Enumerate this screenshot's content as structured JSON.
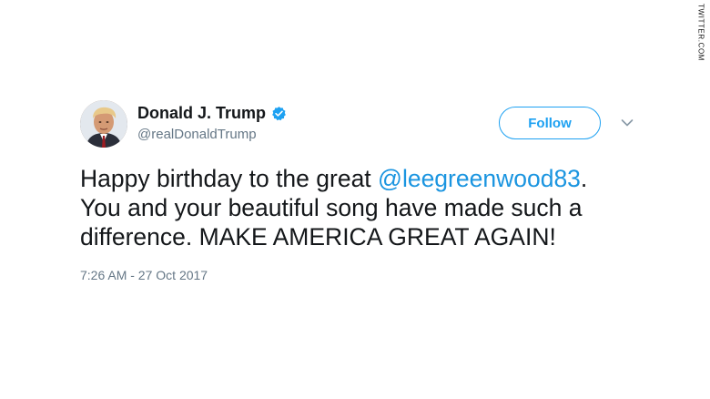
{
  "credit": "TWITTER.COM",
  "tweet": {
    "display_name": "Donald J. Trump",
    "handle": "@realDonaldTrump",
    "follow_label": "Follow",
    "text_before": "Happy birthday to the great ",
    "mention": "@leegreenwood83",
    "text_after": ". You and your beautiful song have made such a difference. MAKE AMERICA GREAT AGAIN!",
    "timestamp": "7:26 AM - 27 Oct 2017"
  },
  "colors": {
    "accent": "#1da1f2",
    "mention": "#1b95e0",
    "secondary_text": "#657786",
    "primary_text": "#14171a"
  },
  "icons": {
    "verified": "verified-badge-icon",
    "more": "chevron-down-icon",
    "avatar": "profile-avatar"
  }
}
